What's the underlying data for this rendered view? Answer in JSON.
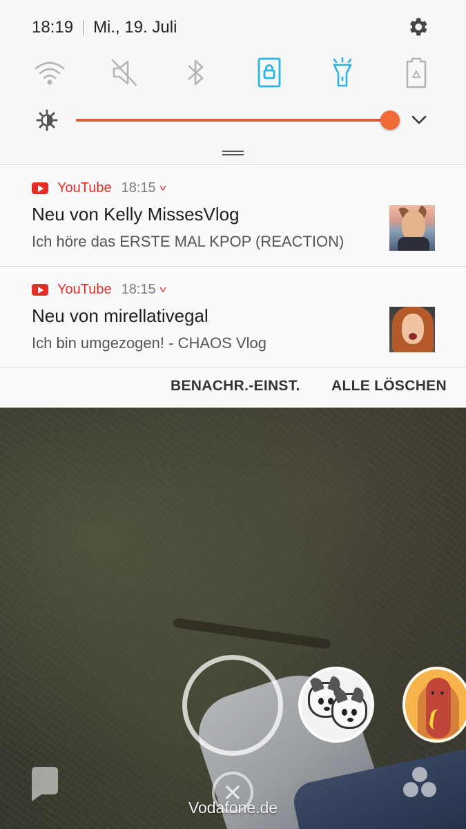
{
  "status_bar": {
    "time": "18:19",
    "date": "Mi., 19. Juli"
  },
  "quick_settings": [
    {
      "name": "wifi",
      "icon": "wifi-icon",
      "active": false
    },
    {
      "name": "sound",
      "icon": "mute-icon",
      "active": false
    },
    {
      "name": "bluetooth",
      "icon": "bluetooth-icon",
      "active": false
    },
    {
      "name": "screen-rotation-lock",
      "icon": "rotation-lock-icon",
      "active": true
    },
    {
      "name": "flashlight",
      "icon": "flashlight-icon",
      "active": true
    },
    {
      "name": "power-saving",
      "icon": "battery-recycle-icon",
      "active": false
    }
  ],
  "brightness": {
    "level": 1.0
  },
  "colors": {
    "accent_blue": "#2ab2e4",
    "slider_orange": "#ef6a35",
    "youtube_red": "#e52d27"
  },
  "notifications": [
    {
      "app": "YouTube",
      "time": "18:15",
      "title": "Neu von Kelly MissesVlog",
      "text": "Ich höre das ERSTE MAL KPOP (REACTION)"
    },
    {
      "app": "YouTube",
      "time": "18:15",
      "title": "Neu von mirellativegal",
      "text": "Ich bin umgezogen! - CHAOS Vlog"
    }
  ],
  "actions": {
    "notification_settings": "BENACHR.-EINST.",
    "clear_all": "ALLE LÖSCHEN"
  },
  "camera": {
    "carrier": "Vodafone.de"
  }
}
